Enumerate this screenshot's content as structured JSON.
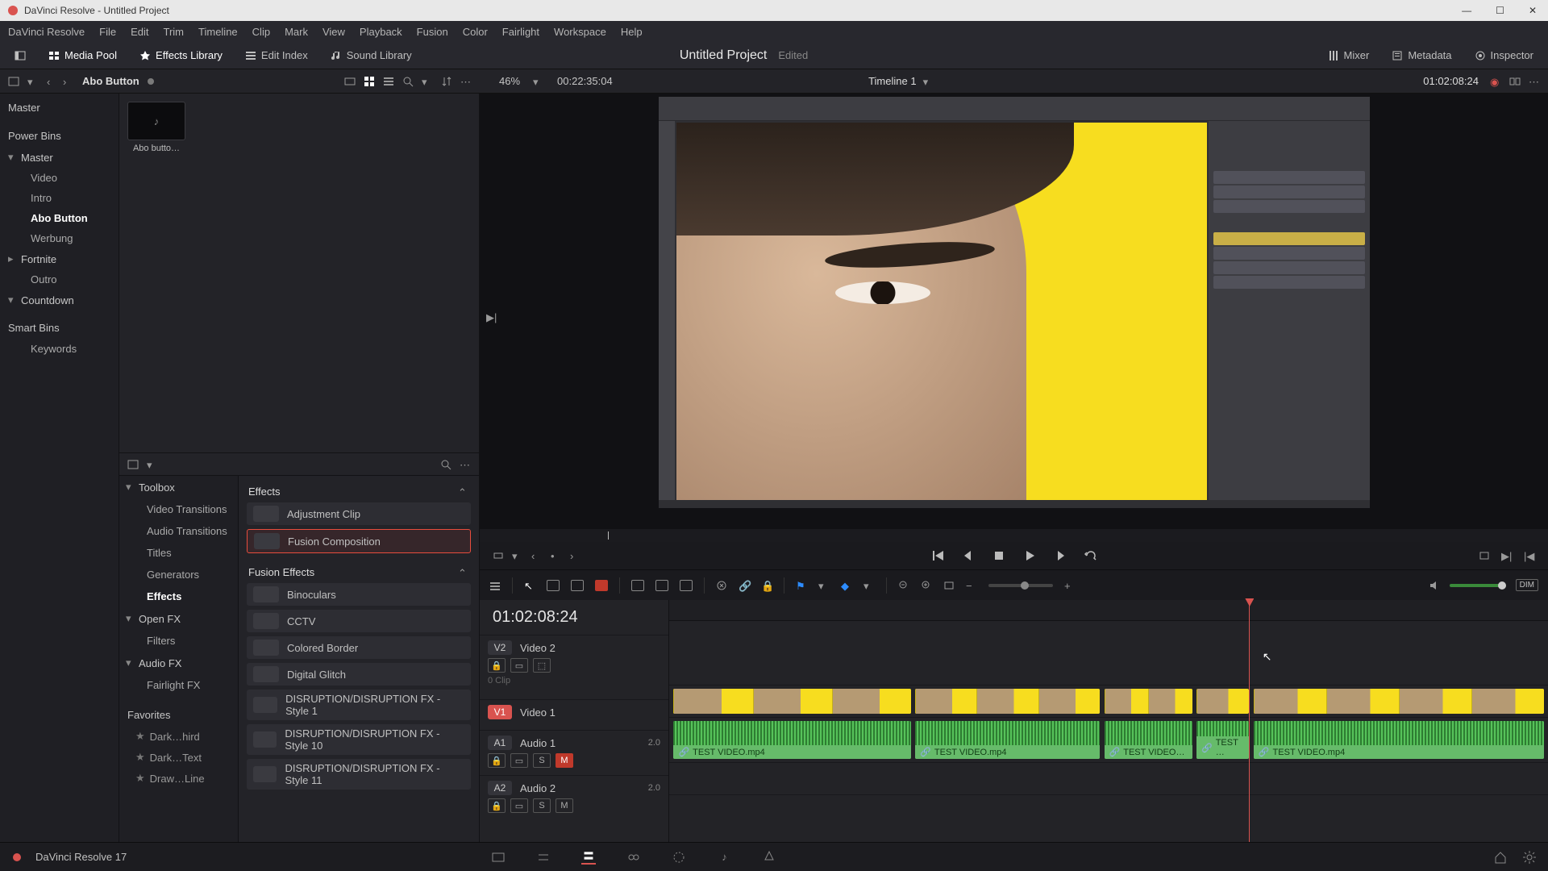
{
  "titlebar": {
    "text": "DaVinci Resolve - Untitled Project"
  },
  "menu": [
    "DaVinci Resolve",
    "File",
    "Edit",
    "Trim",
    "Timeline",
    "Clip",
    "Mark",
    "View",
    "Playback",
    "Fusion",
    "Color",
    "Fairlight",
    "Workspace",
    "Help"
  ],
  "toolbar": {
    "media_pool": "Media Pool",
    "effects_library": "Effects Library",
    "edit_index": "Edit Index",
    "sound_library": "Sound Library",
    "mixer": "Mixer",
    "metadata": "Metadata",
    "inspector": "Inspector"
  },
  "project": {
    "title": "Untitled Project",
    "status": "Edited"
  },
  "subheader": {
    "breadcrumb": "Abo Button",
    "zoom": "46%",
    "source_tc": "00:22:35:04",
    "timeline_name": "Timeline 1",
    "timeline_tc": "01:02:08:24"
  },
  "bins": {
    "master": "Master",
    "power_bins": "Power Bins",
    "items": [
      "Master",
      "Video",
      "Intro",
      "Abo Button",
      "Werbung",
      "Fortnite",
      "Outro",
      "Countdown"
    ],
    "smart_bins": "Smart Bins",
    "smart_items": [
      "Keywords"
    ]
  },
  "favorites": {
    "title": "Favorites",
    "items": [
      "Dark…hird",
      "Dark…Text",
      "Draw…Line"
    ]
  },
  "toolbox": {
    "header": "Toolbox",
    "items": [
      "Video Transitions",
      "Audio Transitions",
      "Titles",
      "Generators",
      "Effects"
    ],
    "openfx": "Open FX",
    "openfx_items": [
      "Filters"
    ],
    "audiofx": "Audio FX",
    "audiofx_items": [
      "Fairlight FX"
    ]
  },
  "effects_panel": {
    "group1": "Effects",
    "group1_items": [
      "Adjustment Clip",
      "Fusion Composition"
    ],
    "group2": "Fusion Effects",
    "group2_items": [
      "Binoculars",
      "CCTV",
      "Colored Border",
      "Digital Glitch",
      "DISRUPTION/DISRUPTION FX - Style 1",
      "DISRUPTION/DISRUPTION FX - Style 10",
      "DISRUPTION/DISRUPTION FX - Style 11"
    ]
  },
  "media": {
    "clip_name": "Abo butto…"
  },
  "timeline": {
    "tc": "01:02:08:24",
    "tracks": {
      "v2": {
        "tag": "V2",
        "name": "Video 2",
        "sub": "0 Clip"
      },
      "v1": {
        "tag": "V1",
        "name": "Video 1"
      },
      "a1": {
        "tag": "A1",
        "name": "Audio 1",
        "ch": "2.0",
        "s": "S",
        "m": "M"
      },
      "a2": {
        "tag": "A2",
        "name": "Audio 2",
        "ch": "2.0",
        "s": "S",
        "m": "M"
      }
    },
    "clips": {
      "a": "TEST VIDEO.mp4",
      "b": "TEST VIDEO.mp4",
      "c": "TEST VIDEO…",
      "d": "TEST …",
      "e": "TEST VIDEO.mp4"
    }
  },
  "appbar": {
    "label": "DaVinci Resolve 17"
  },
  "icons": {
    "lock": "🔒",
    "link": "🔗",
    "dim": "DIM"
  }
}
